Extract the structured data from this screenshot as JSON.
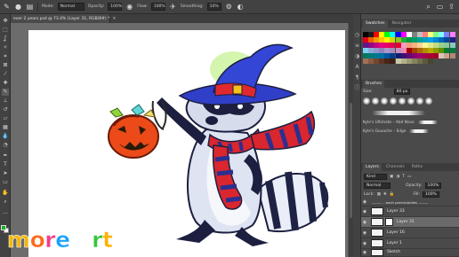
{
  "app": {
    "name": "Photoshop"
  },
  "options_bar": {
    "mode_label": "Mode:",
    "mode_value": "Normal",
    "opacity_label": "Opacity:",
    "opacity_value": "100%",
    "flow_label": "Flow:",
    "flow_value": "100%",
    "smoothing_label": "Smoothing:",
    "smoothing_value": "10%",
    "icons": [
      "brush-tool-icon",
      "brush-preset-icon",
      "toggle-brush-panel-icon",
      "airbrush-icon",
      "settings-icon",
      "pressure-icon",
      "symmetry-icon"
    ]
  },
  "document": {
    "tab_title": "ever 2 years.psd @ 73.4% (Layer 31, RGB/8#) *",
    "close": "×"
  },
  "toolbar": {
    "tools": [
      "move-tool-icon",
      "marquee-tool-icon",
      "lasso-tool-icon",
      "quick-select-tool-icon",
      "crop-tool-icon",
      "frame-tool-icon",
      "eyedropper-tool-icon",
      "healing-tool-icon",
      "brush-tool-icon",
      "stamp-tool-icon",
      "history-brush-icon",
      "eraser-tool-icon",
      "gradient-tool-icon",
      "blur-tool-icon",
      "dodge-tool-icon",
      "pen-tool-icon",
      "type-tool-icon",
      "path-select-tool-icon",
      "shape-tool-icon",
      "hand-tool-icon",
      "zoom-tool-icon",
      "edit-toolbar-icon"
    ],
    "foreground_color": "#0fb41f",
    "background_color": "#ffffff"
  },
  "swatches_panel": {
    "tabs": [
      "Swatches",
      "Navigator"
    ],
    "active_tab": "Swatches",
    "colors": [
      "#000000",
      "#1c1c1c",
      "#ff0000",
      "#ffff00",
      "#00ff00",
      "#00ffff",
      "#0000ff",
      "#ff00ff",
      "#ffffff",
      "#7f7f7f",
      "#c0c0c0",
      "#ff7f7f",
      "#ffff7f",
      "#7fff7f",
      "#7fffff",
      "#7f7fff",
      "#ff7fff",
      "#e60012",
      "#eb6100",
      "#f39800",
      "#fcc800",
      "#fff100",
      "#cfdb00",
      "#8fc31f",
      "#22ac38",
      "#009944",
      "#009b6b",
      "#009e96",
      "#00a0c1",
      "#00a0e9",
      "#0086d1",
      "#0068b7",
      "#00479d",
      "#1d2088",
      "#601986",
      "#920783",
      "#be0081",
      "#e4007f",
      "#e5006a",
      "#e5004f",
      "#e60033",
      "#f19ec2",
      "#f39c7e",
      "#f6b37f",
      "#fad095",
      "#fff799",
      "#e1e98c",
      "#c1db81",
      "#98cf89",
      "#8ac999",
      "#85cbbf",
      "#7ecef4",
      "#88abda",
      "#8c97cb",
      "#8f82bc",
      "#a59aca",
      "#aa89bd",
      "#c490bf",
      "#ee87b4",
      "#a40000",
      "#a84200",
      "#ac6a00",
      "#b48c00",
      "#b7aa00",
      "#8f9b00",
      "#5f8e00",
      "#007b2c",
      "#007940",
      "#00785f",
      "#007979",
      "#007a8a",
      "#006ea7",
      "#00559d",
      "#003f8e",
      "#0a1e73",
      "#3f0f72",
      "#650972",
      "#840073",
      "#a1006b",
      "#a4004e",
      "#a50036",
      "#a50021",
      "#d7c4bb",
      "#c9a38f",
      "#b5866f",
      "#a07056",
      "#8a5a41",
      "#744630",
      "#5d3423",
      "#472717",
      "#3b2011",
      "#c8c8a9",
      "#b3b08c",
      "#9c9a74",
      "#86845f",
      "#706f4d",
      "#5b5a3d",
      "#47462e"
    ]
  },
  "brushes_panel": {
    "title": "Brushes",
    "size_label": "Size:",
    "size_value": "80 px",
    "items": [
      "Kyle's Ultimate – Abd Novo",
      "Kyle's Gouache – Edge"
    ]
  },
  "layers_panel": {
    "tabs": [
      "Layers",
      "Channels",
      "Paths"
    ],
    "active_tab": "Layers",
    "kind_label": "Kind",
    "blend_mode": "Normal",
    "opacity_label": "Opacity:",
    "opacity_value": "100%",
    "lock_label": "Lock:",
    "fill_label": "Fill:",
    "fill_value": "100%",
    "layers": [
      {
        "name": "-------- ...each parent/oldies --------",
        "selected": false
      },
      {
        "name": "Layer 33",
        "selected": false
      },
      {
        "name": "Layer 31",
        "selected": true
      },
      {
        "name": "Layer 16",
        "selected": false
      },
      {
        "name": "Layer 1",
        "selected": false
      },
      {
        "name": "Sketch",
        "selected": false
      }
    ]
  },
  "watermark": {
    "text": "more art",
    "letter_colors": [
      "#f4b700",
      "#ff6a1a",
      "#f23c8c",
      "#1aa2ff",
      "#ffffff",
      "#37c63b",
      "#ffb100",
      "#ff6a1a"
    ]
  }
}
